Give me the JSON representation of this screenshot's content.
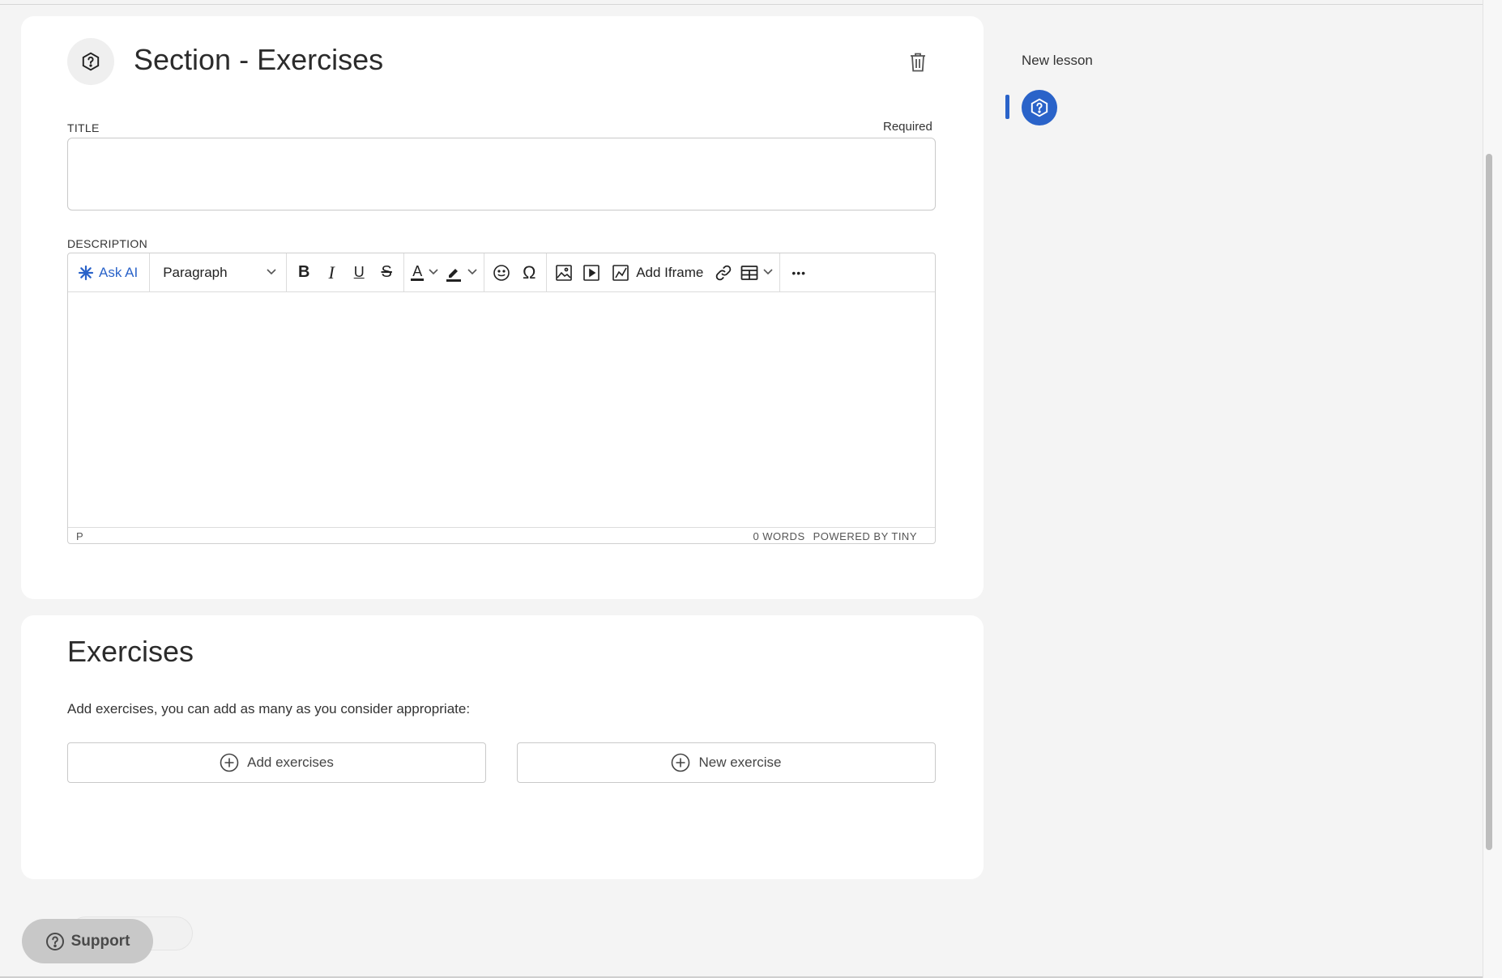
{
  "section": {
    "title": "Section - Exercises",
    "title_label": "TITLE",
    "required_label": "Required",
    "title_value": "",
    "description_label": "DESCRIPTION"
  },
  "editor": {
    "ask_ai": "Ask AI",
    "block_format": "Paragraph",
    "bold": "B",
    "italic": "I",
    "underline": "U",
    "strikethrough": "S",
    "text_color": "A",
    "special_char": "Ω",
    "add_iframe": "Add Iframe",
    "more": "•••",
    "path": "P",
    "word_count": "0 WORDS",
    "powered_by": "POWERED BY TINY"
  },
  "exercises": {
    "title": "Exercises",
    "description": "Add exercises, you can add as many as you consider appropriate:",
    "add_button": "Add exercises",
    "new_button": "New exercise"
  },
  "sidebar": {
    "lesson_title": "New lesson"
  },
  "support": {
    "label": "Support"
  },
  "colors": {
    "accent": "#2a63c9",
    "card": "#ffffff",
    "background": "#f4f4f4"
  }
}
